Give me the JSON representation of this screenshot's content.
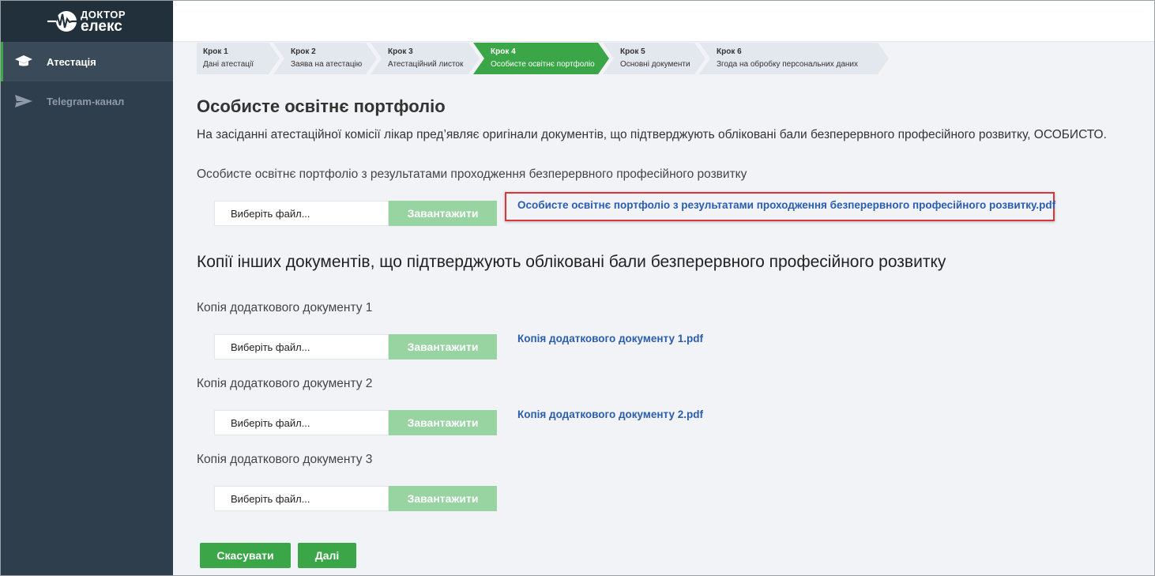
{
  "logo": {
    "line1": "ДОКТОР",
    "line2": "елекс"
  },
  "sidebar": {
    "items": [
      {
        "label": "Атестація",
        "icon": "graduation-cap-icon",
        "active": true
      },
      {
        "label": "Telegram-канал",
        "icon": "paper-plane-icon",
        "active": false
      }
    ]
  },
  "steps": [
    {
      "num": "Крок 1",
      "label": "Дані атестації"
    },
    {
      "num": "Крок 2",
      "label": "Заява на атестацію"
    },
    {
      "num": "Крок 3",
      "label": "Атестаційний листок"
    },
    {
      "num": "Крок 4",
      "label": "Особисте освітнє портфоліо",
      "active": true
    },
    {
      "num": "Крок 5",
      "label": "Основні документи"
    },
    {
      "num": "Крок 6",
      "label": "Згода на обробку персональних даних"
    }
  ],
  "page": {
    "title": "Особисте освітнє портфоліо",
    "intro": "На засіданні атестаційної комісії лікар пред’являє оригінали документів, що підтверджують обліковані бали безперервного професійного розвитку, ОСОБИСТО."
  },
  "portfolio": {
    "label": "Особисте освітнє портфоліо з результатами проходження безперервного професійного розвитку",
    "file_placeholder": "Виберіть файл...",
    "upload_label": "Завантажити",
    "file_link": "Особисте освітнє портфоліо з результатами проходження безперервного професійного розвитку.pdf"
  },
  "copies": {
    "title": "Копії інших документів, що підтверджують обліковані бали безперервного професійного розвитку",
    "docs": [
      {
        "label": "Копія додаткового документу 1",
        "file_placeholder": "Виберіть файл...",
        "upload_label": "Завантажити",
        "file_link": "Копія додаткового документу 1.pdf"
      },
      {
        "label": "Копія додаткового документу 2",
        "file_placeholder": "Виберіть файл...",
        "upload_label": "Завантажити",
        "file_link": "Копія додаткового документу 2.pdf"
      },
      {
        "label": "Копія додаткового документу 3",
        "file_placeholder": "Виберіть файл...",
        "upload_label": "Завантажити",
        "file_link": ""
      }
    ]
  },
  "actions": {
    "cancel_label": "Скасувати",
    "next_label": "Далі"
  },
  "colors": {
    "accent": "#3aa648",
    "sidebar": "#2f3e4c",
    "link": "#2a5db0",
    "highlight": "#d9363e"
  }
}
